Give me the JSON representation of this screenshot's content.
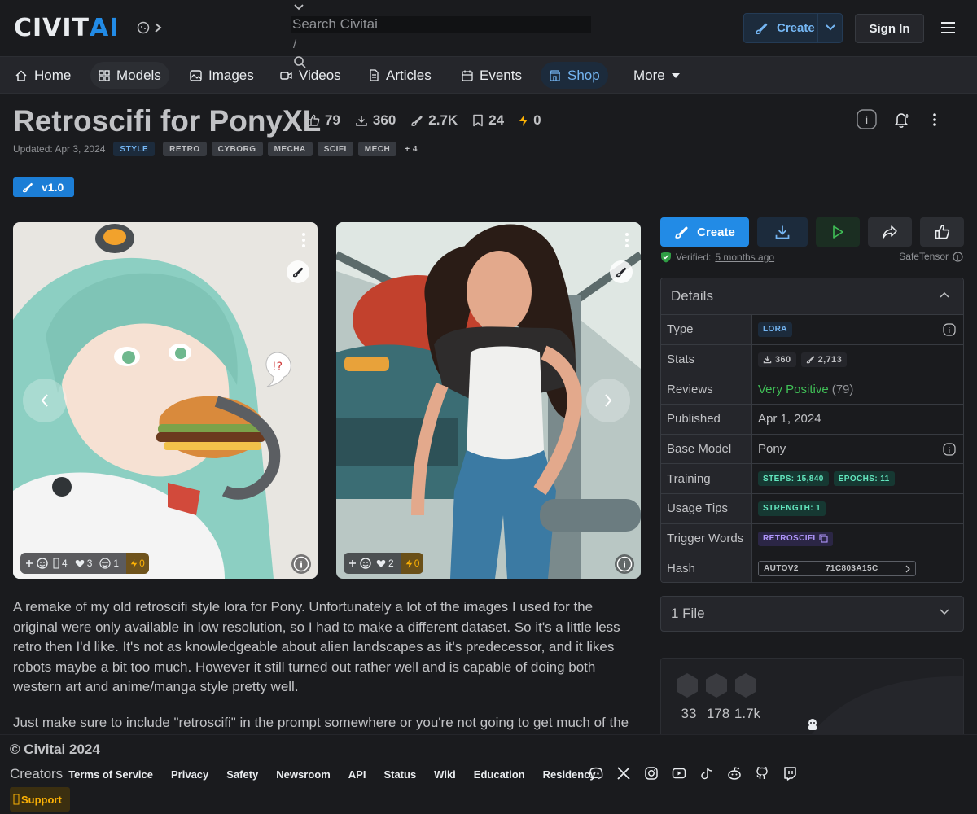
{
  "header": {
    "logo_civ": "CIVIT",
    "logo_ai": "AI",
    "search_placeholder": "Search Civitai",
    "search_shortcut": "/",
    "create_label": "Create",
    "signin_label": "Sign In"
  },
  "nav": {
    "items": [
      {
        "label": "Home",
        "icon": "home-icon"
      },
      {
        "label": "Models",
        "icon": "models-icon"
      },
      {
        "label": "Images",
        "icon": "photo-icon"
      },
      {
        "label": "Videos",
        "icon": "video-icon"
      },
      {
        "label": "Articles",
        "icon": "article-icon"
      },
      {
        "label": "Events",
        "icon": "calendar-icon"
      },
      {
        "label": "Shop",
        "icon": "shop-icon"
      },
      {
        "label": "More",
        "icon": "caret-down-icon"
      }
    ]
  },
  "model": {
    "title": "Retroscifi for PonyXL",
    "stats": {
      "likes": "79",
      "downloads": "360",
      "generations": "2.7K",
      "bookmarks": "24",
      "buzz": "0"
    },
    "updated": "Updated: Apr 3, 2024",
    "tags": [
      "STYLE",
      "RETRO",
      "CYBORG",
      "MECHA",
      "SCIFI",
      "MECH"
    ],
    "more_tags": "+ 4",
    "version": "v1.0"
  },
  "gallery": {
    "image1": {
      "reactions": {
        "laugh": "4",
        "heart": "3",
        "cry": "1",
        "buzz": "0"
      }
    },
    "image2": {
      "reactions": {
        "heart": "2",
        "buzz": "0"
      }
    }
  },
  "description": {
    "para1": "A remake of my old retroscifi style lora for Pony. Unfortunately a lot of the images I used for the original were only available in low resolution, so I had to make a different dataset. So it's a little less retro then I'd like. It's not as knowledgeable about alien landscapes as it's predecessor, and it likes robots maybe a bit too much. However it still turned out rather well and is capable of doing both western art and anime/manga style pretty well.",
    "para2": "Just make sure to include \"retroscifi\" in the prompt somewhere or you're not going to get much of the"
  },
  "actions": {
    "create_label": "Create",
    "verified_prefix": "Verified:",
    "verified_when": "5 months ago",
    "safetensor": "SafeTensor"
  },
  "details": {
    "header": "Details",
    "rows": {
      "type": {
        "key": "Type",
        "value": "LORA"
      },
      "stats": {
        "key": "Stats",
        "downloads": "360",
        "generations": "2,713"
      },
      "reviews": {
        "key": "Reviews",
        "rating": "Very Positive",
        "count": "(79)"
      },
      "published": {
        "key": "Published",
        "value": "Apr 1, 2024"
      },
      "base_model": {
        "key": "Base Model",
        "value": "Pony"
      },
      "training": {
        "key": "Training",
        "steps": "STEPS: 15,840",
        "epochs": "EPOCHS: 11"
      },
      "usage_tips": {
        "key": "Usage Tips",
        "value": "STRENGTH: 1"
      },
      "trigger_words": {
        "key": "Trigger Words",
        "value": "RETROSCIFI"
      },
      "hash": {
        "key": "Hash",
        "algo": "AUTOV2",
        "value": "71C803A15C"
      }
    }
  },
  "files": {
    "label": "1 File"
  },
  "creator": {
    "stats": [
      "33",
      "178",
      "1.7k"
    ]
  },
  "footer": {
    "copyright": "© Civitai 2024",
    "creators": "Creators",
    "links": [
      "Terms of Service",
      "Privacy",
      "Safety",
      "Newsroom",
      "API",
      "Status",
      "Wiki",
      "Education",
      "Residency"
    ],
    "support": "Support",
    "socials": [
      "discord-icon",
      "x-icon",
      "instagram-icon",
      "youtube-icon",
      "tiktok-icon",
      "reddit-icon",
      "github-icon",
      "twitch-icon"
    ]
  }
}
